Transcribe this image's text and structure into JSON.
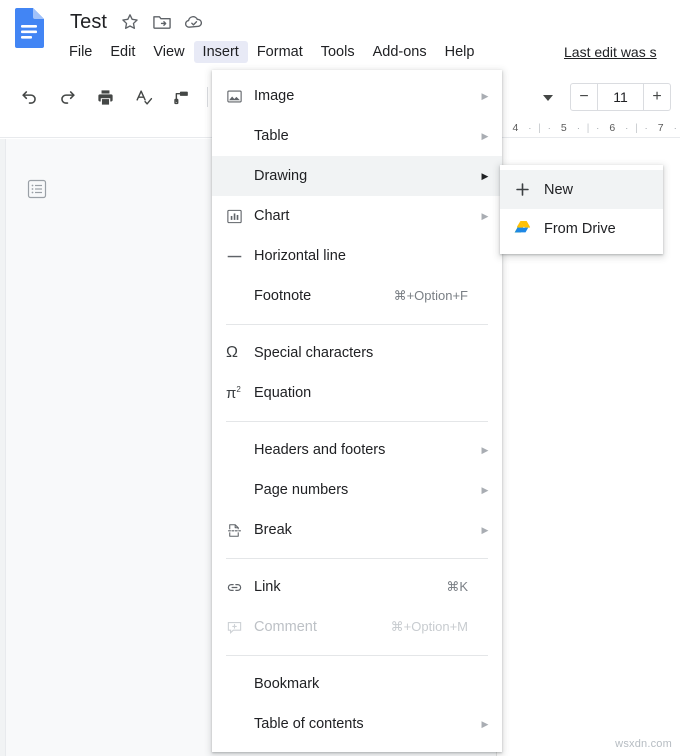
{
  "app": {
    "name": "Google Docs",
    "logo_icon": "docs-file-icon",
    "logo_color": "#4285f4"
  },
  "header": {
    "doc_title": "Test",
    "title_icons": [
      {
        "name": "star-icon",
        "label": "Star"
      },
      {
        "name": "move-to-folder-icon",
        "label": "Move"
      },
      {
        "name": "cloud-saved-icon",
        "label": "See document status"
      }
    ],
    "menubar": [
      {
        "label": "File",
        "name": "menu-file",
        "active": false
      },
      {
        "label": "Edit",
        "name": "menu-edit",
        "active": false
      },
      {
        "label": "View",
        "name": "menu-view",
        "active": false
      },
      {
        "label": "Insert",
        "name": "menu-insert",
        "active": true
      },
      {
        "label": "Format",
        "name": "menu-format",
        "active": false
      },
      {
        "label": "Tools",
        "name": "menu-tools",
        "active": false
      },
      {
        "label": "Add-ons",
        "name": "menu-addons",
        "active": false
      },
      {
        "label": "Help",
        "name": "menu-help",
        "active": false
      }
    ],
    "last_edit": "Last edit was s"
  },
  "toolbar": {
    "icons": [
      {
        "name": "undo-icon",
        "label": "Undo"
      },
      {
        "name": "redo-icon",
        "label": "Redo"
      },
      {
        "name": "print-icon",
        "label": "Print"
      },
      {
        "name": "spelling-check-icon",
        "label": "Spelling and grammar check"
      },
      {
        "name": "paint-format-icon",
        "label": "Paint format"
      }
    ],
    "caret_icon": "chevron-down-icon",
    "font_size": {
      "decrease_label": "−",
      "value": "11",
      "increase_label": "+"
    }
  },
  "ruler": {
    "marks": [
      "4",
      "5",
      "6",
      "7"
    ]
  },
  "sidebar": {
    "outline_icon": "document-outline-icon"
  },
  "insert_menu": {
    "highlight_color": "#f1f3f4",
    "items": [
      {
        "label": "Image",
        "icon": "image-icon",
        "accel": "",
        "arrow": true,
        "highlighted": false,
        "disabled": false,
        "name": "insert-image"
      },
      {
        "label": "Table",
        "icon": "",
        "accel": "",
        "arrow": true,
        "highlighted": false,
        "disabled": false,
        "name": "insert-table"
      },
      {
        "label": "Drawing",
        "icon": "",
        "accel": "",
        "arrow": true,
        "highlighted": true,
        "disabled": false,
        "name": "insert-drawing"
      },
      {
        "label": "Chart",
        "icon": "chart-icon",
        "accel": "",
        "arrow": true,
        "highlighted": false,
        "disabled": false,
        "name": "insert-chart"
      },
      {
        "label": "Horizontal line",
        "icon": "horizontal-line-icon",
        "accel": "",
        "arrow": false,
        "highlighted": false,
        "disabled": false,
        "name": "insert-horizontal-line"
      },
      {
        "label": "Footnote",
        "icon": "",
        "accel": "⌘+Option+F",
        "arrow": false,
        "highlighted": false,
        "disabled": false,
        "name": "insert-footnote"
      },
      {
        "separator": true
      },
      {
        "label": "Special characters",
        "icon": "omega-icon",
        "accel": "",
        "arrow": false,
        "highlighted": false,
        "disabled": false,
        "name": "insert-special-characters"
      },
      {
        "label": "Equation",
        "icon": "equation-icon",
        "accel": "",
        "arrow": false,
        "highlighted": false,
        "disabled": false,
        "name": "insert-equation"
      },
      {
        "separator": true
      },
      {
        "label": "Headers and footers",
        "icon": "",
        "accel": "",
        "arrow": true,
        "highlighted": false,
        "disabled": false,
        "name": "insert-headers-and-footers"
      },
      {
        "label": "Page numbers",
        "icon": "",
        "accel": "",
        "arrow": true,
        "highlighted": false,
        "disabled": false,
        "name": "insert-page-numbers"
      },
      {
        "label": "Break",
        "icon": "break-icon",
        "accel": "",
        "arrow": true,
        "highlighted": false,
        "disabled": false,
        "name": "insert-break"
      },
      {
        "separator": true
      },
      {
        "label": "Link",
        "icon": "link-icon",
        "accel": "⌘K",
        "arrow": false,
        "highlighted": false,
        "disabled": false,
        "name": "insert-link"
      },
      {
        "label": "Comment",
        "icon": "comment-icon",
        "accel": "⌘+Option+M",
        "arrow": false,
        "highlighted": false,
        "disabled": true,
        "name": "insert-comment"
      },
      {
        "separator": true
      },
      {
        "label": "Bookmark",
        "icon": "",
        "accel": "",
        "arrow": false,
        "highlighted": false,
        "disabled": false,
        "name": "insert-bookmark"
      },
      {
        "label": "Table of contents",
        "icon": "",
        "accel": "",
        "arrow": true,
        "highlighted": false,
        "disabled": false,
        "name": "insert-table-of-contents"
      }
    ]
  },
  "drawing_submenu": {
    "items": [
      {
        "label": "New",
        "icon": "plus-icon",
        "highlighted": true,
        "name": "drawing-new"
      },
      {
        "label": "From Drive",
        "icon": "google-drive-icon",
        "highlighted": false,
        "name": "drawing-from-drive"
      }
    ]
  },
  "watermark": {
    "text": "wsxdn.com"
  }
}
